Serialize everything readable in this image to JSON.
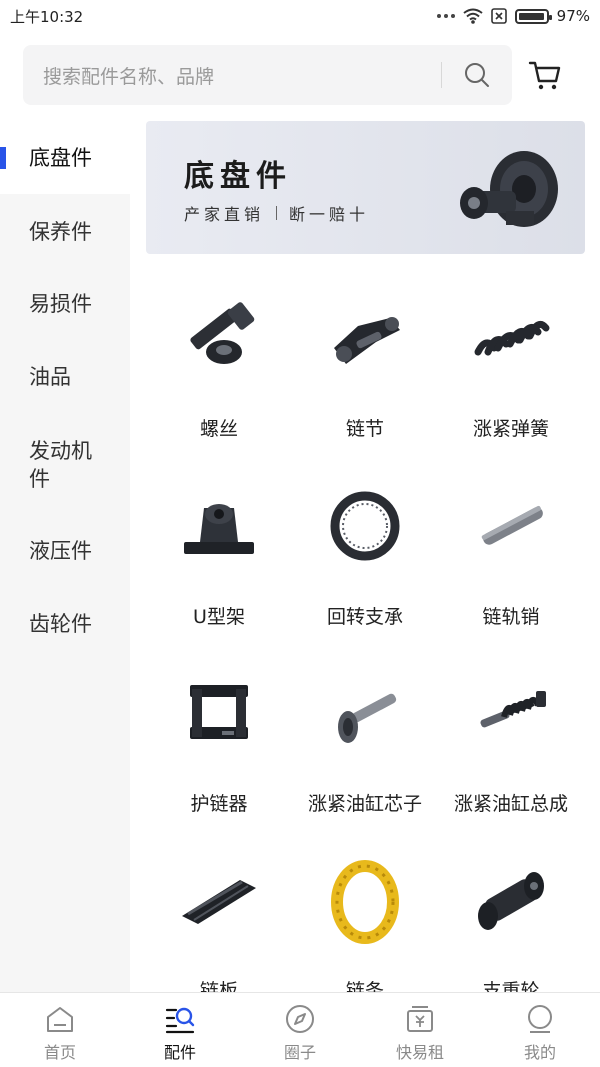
{
  "status_bar": {
    "time": "上午10:32",
    "battery": "97%",
    "battery_level": 0.97
  },
  "search": {
    "placeholder": "搜索配件名称、品牌"
  },
  "sidebar": {
    "items": [
      {
        "label": "底盘件"
      },
      {
        "label": "保养件"
      },
      {
        "label": "易损件"
      },
      {
        "label": "油品"
      },
      {
        "label": "发动机件"
      },
      {
        "label": "液压件"
      },
      {
        "label": "齿轮件"
      }
    ]
  },
  "banner": {
    "title": "底盘件",
    "subtitle_left": "产家直销",
    "subtitle_right": "断一赔十"
  },
  "products": [
    {
      "label": "螺丝",
      "icon": "bolt-icon"
    },
    {
      "label": "链节",
      "icon": "chain-link-icon"
    },
    {
      "label": "涨紧弹簧",
      "icon": "spring-icon"
    },
    {
      "label": "U型架",
      "icon": "u-bracket-icon"
    },
    {
      "label": "回转支承",
      "icon": "slewing-bearing-icon"
    },
    {
      "label": "链轨销",
      "icon": "track-pin-icon"
    },
    {
      "label": "护链器",
      "icon": "chain-guard-icon"
    },
    {
      "label": "涨紧油缸芯子",
      "icon": "cylinder-core-icon"
    },
    {
      "label": "涨紧油缸总成",
      "icon": "cylinder-assembly-icon"
    },
    {
      "label": "链板",
      "icon": "track-shoe-icon"
    },
    {
      "label": "链条",
      "icon": "track-chain-icon"
    },
    {
      "label": "支重轮",
      "icon": "track-roller-icon"
    }
  ],
  "bottom_nav": [
    {
      "label": "首页",
      "icon": "home-icon"
    },
    {
      "label": "配件",
      "icon": "parts-icon"
    },
    {
      "label": "圈子",
      "icon": "compass-icon"
    },
    {
      "label": "快易租",
      "icon": "rent-icon"
    },
    {
      "label": "我的",
      "icon": "profile-icon"
    }
  ],
  "colors": {
    "accent": "#2954e8",
    "sidebar_bg": "#f6f6f6"
  }
}
